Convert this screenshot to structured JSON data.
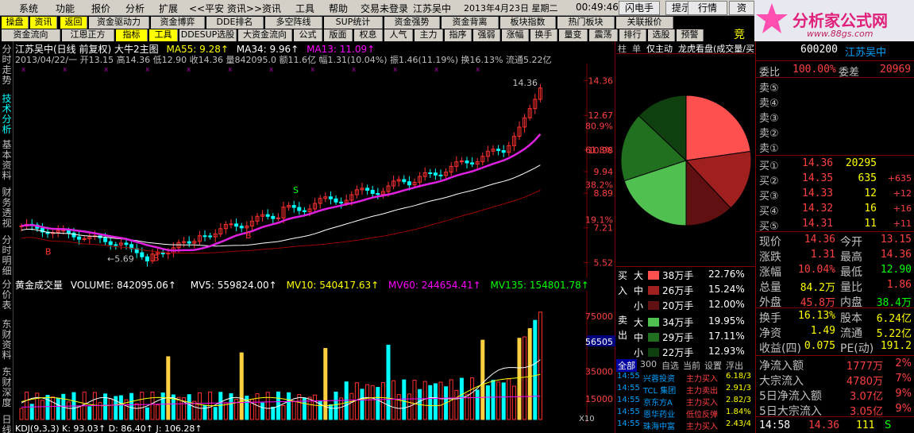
{
  "menu": {
    "items": [
      "系统",
      "功能",
      "报价",
      "分析",
      "扩展",
      "<<平安 资讯>>",
      "资讯",
      "工具",
      "帮助",
      "交易未登录",
      "江苏吴中",
      "2013年4月23日 星期二",
      "00:49:46"
    ],
    "buttons": [
      "闪电手",
      "提示",
      "行情",
      "资"
    ]
  },
  "toolbar1": [
    "操盘",
    "资讯",
    "返回",
    "资金驱动力",
    "资金博弈",
    "DDE排名",
    "多空阵线",
    "SUP统计",
    "资金强势",
    "资金背离",
    "板块指数",
    "热门板块",
    "关联报价"
  ],
  "toolbar2": [
    "资金流向",
    "江恩正方",
    "指标",
    "工具",
    "DDESUP选股",
    "大资金流向",
    "公式",
    "版面",
    "权息",
    "人气",
    "主力",
    "指序",
    "强弱",
    "涨幅",
    "换手",
    "量变",
    "震荡",
    "排行",
    "选股",
    "预警"
  ],
  "toolbar_overflow": "竞",
  "leftnav": [
    "分时走势",
    "技术分析",
    "基本资料",
    "财务透视",
    "分时明细",
    "分价表",
    "东财资料",
    "东财深度",
    "日线"
  ],
  "chart": {
    "title": "江苏吴中(日线 前复权) 大牛2主图",
    "ma55": "MA55: 9.28↑",
    "ma34": "MA34: 9.96↑",
    "ma13": "MA13: 11.09↑",
    "info": "2013/04/22/一 开13.15 高14.36 低12.90 收14.36 量842095.0 额11.6亿 幅1.31(10.04%) 振1.46(11.19%) 换16.13% 流通5.22亿",
    "price_ticks": [
      "14.36",
      "12.67",
      "10.98",
      "9.94",
      "8.89",
      "7.21",
      "5.52"
    ],
    "pct_ticks": [
      "80.9%",
      "61.8%",
      "38.2%",
      "19.1%"
    ],
    "high_label": "14.36",
    "low_label": "←5.69",
    "vol_title": "黄金成交量",
    "vol": "VOLUME: 842095.06↑",
    "mv5": "MV5: 559824.00↑",
    "mv10": "MV10: 540417.63↑",
    "mv60": "MV60: 244654.41↑",
    "mv135": "MV135: 154801.78↑",
    "vol_ticks": [
      "75000",
      "56505",
      "35000",
      "15000"
    ],
    "vol_unit": "X10",
    "kdj": "KDJ(9,3,3)  K: 93.03↑  D: 86.40↑  J: 106.28↑",
    "markers": {
      "b": "B",
      "s": "S",
      "x": "x"
    }
  },
  "chart_data": {
    "type": "candlestick",
    "series": [
      {
        "name": "MA13",
        "value": 11.09
      },
      {
        "name": "MA34",
        "value": 9.96
      },
      {
        "name": "MA55",
        "value": 9.28
      }
    ],
    "last": {
      "open": 13.15,
      "high": 14.36,
      "low": 12.9,
      "close": 14.36,
      "volume": 842095.0
    },
    "ylim": [
      5.52,
      14.36
    ]
  },
  "tabs_top": [
    "柱",
    "单",
    "仅主动",
    "龙虎看盘(成交量/买"
  ],
  "pie": {
    "slices": [
      {
        "label": "买 大",
        "value": 22.76,
        "color": "#ff5050"
      },
      {
        "label": "买 中",
        "value": 15.24,
        "color": "#a02020"
      },
      {
        "label": "买 小",
        "value": 12.0,
        "color": "#601010"
      },
      {
        "label": "卖 大",
        "value": 19.95,
        "color": "#50c050"
      },
      {
        "label": "卖 中",
        "value": 17.11,
        "color": "#207020"
      },
      {
        "label": "卖 小",
        "value": 12.93,
        "color": "#104010"
      }
    ]
  },
  "flow": {
    "buy_label": "买入",
    "sell_label": "卖出",
    "rows": [
      {
        "size": "大",
        "amt": "38万手",
        "pct": "22.76%",
        "color": "#ff5050"
      },
      {
        "size": "中",
        "amt": "26万手",
        "pct": "15.24%",
        "color": "#a02020"
      },
      {
        "size": "小",
        "amt": "20万手",
        "pct": "12.00%",
        "color": "#601010"
      },
      {
        "size": "大",
        "amt": "34万手",
        "pct": "19.95%",
        "color": "#50c050"
      },
      {
        "size": "中",
        "amt": "29万手",
        "pct": "17.11%",
        "color": "#207020"
      },
      {
        "size": "小",
        "amt": "22万手",
        "pct": "12.93%",
        "color": "#104010"
      }
    ]
  },
  "news_tabs": [
    "全部",
    "300",
    "自选",
    "当前",
    "设置",
    "浮出"
  ],
  "news": [
    {
      "t": "14:55",
      "n": "兴蓉投资",
      "a": "主力买入",
      "v": "6.18/3"
    },
    {
      "t": "14:55",
      "n": "TCL 集团",
      "a": "主力卖出",
      "v": "2.91/3"
    },
    {
      "t": "14:55",
      "n": "京东方A",
      "a": "主力买入",
      "v": "2.82/3"
    },
    {
      "t": "14:55",
      "n": "恩华药业",
      "a": "低位反弹",
      "v": "1.84%"
    },
    {
      "t": "14:55",
      "n": "珠海中富",
      "a": "主力买入",
      "v": "2.43/4"
    }
  ],
  "quote": {
    "code": "600200",
    "name": "江苏吴中",
    "wb_label": "委比",
    "wb": "100.00%",
    "wc_label": "委差",
    "wc": "20969",
    "sells": [
      "卖⑤",
      "卖④",
      "卖③",
      "卖②",
      "卖①"
    ],
    "buys": [
      {
        "l": "买①",
        "p": "14.36",
        "v": "20295",
        "c": ""
      },
      {
        "l": "买②",
        "p": "14.35",
        "v": "635",
        "c": "+635"
      },
      {
        "l": "买③",
        "p": "14.33",
        "v": "12",
        "c": "+12"
      },
      {
        "l": "买④",
        "p": "14.32",
        "v": "16",
        "c": "+16"
      },
      {
        "l": "买⑤",
        "p": "14.31",
        "v": "11",
        "c": "+11"
      }
    ],
    "stats": [
      {
        "a": "现价",
        "av": "14.36",
        "b": "今开",
        "bv": "13.15"
      },
      {
        "a": "涨跌",
        "av": "1.31",
        "b": "最高",
        "bv": "14.36"
      },
      {
        "a": "涨幅",
        "av": "10.04%",
        "b": "最低",
        "bv": "12.90"
      },
      {
        "a": "总量",
        "av": "84.2万",
        "b": "量比",
        "bv": "1.86"
      },
      {
        "a": "外盘",
        "av": "45.8万",
        "b": "内盘",
        "bv": "38.4万"
      }
    ],
    "stats2": [
      {
        "a": "换手",
        "av": "16.13%",
        "b": "股本",
        "bv": "6.24亿"
      },
      {
        "a": "净资",
        "av": "1.49",
        "b": "流通",
        "bv": "5.22亿"
      },
      {
        "a": "收益(四)",
        "av": "0.075",
        "b": "PE(动)",
        "bv": "191.2"
      }
    ],
    "flows": [
      {
        "l": "净流入额",
        "v": "1777万",
        "p": "2%"
      },
      {
        "l": "大宗流入",
        "v": "4780万",
        "p": "7%"
      },
      {
        "l": "5日净流入额",
        "v": "3.07亿",
        "p": "9%"
      },
      {
        "l": "5日大宗流入",
        "v": "3.05亿",
        "p": "9%"
      }
    ],
    "last": {
      "t": "14:58",
      "p": "14.36",
      "v": "111",
      "s": "S"
    }
  },
  "logo": {
    "title": "分析家公式网",
    "url": "www.88gs.com"
  }
}
